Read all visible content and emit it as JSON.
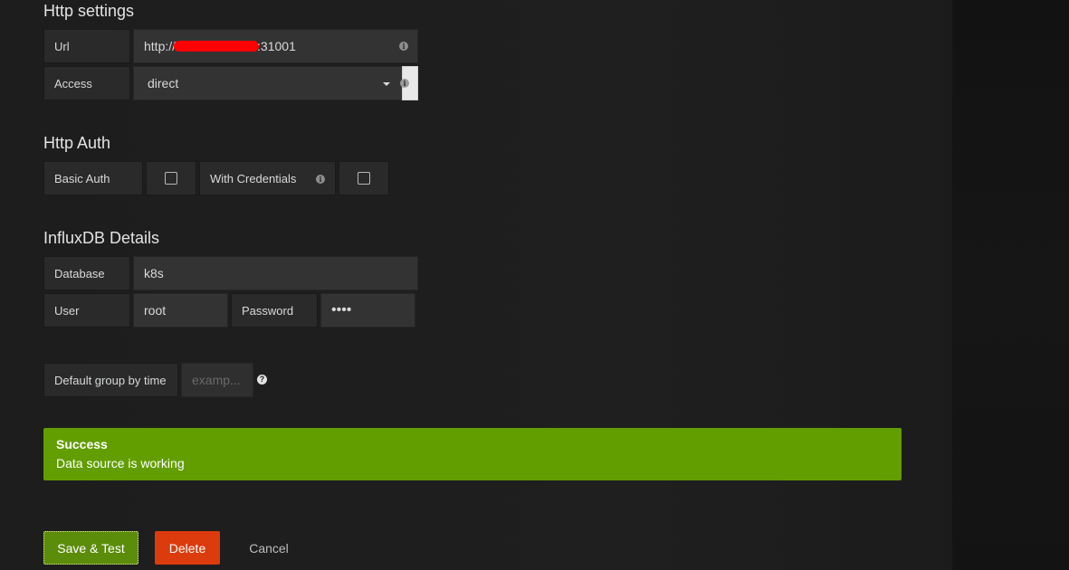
{
  "http_settings": {
    "title": "Http settings",
    "url_label": "Url",
    "url_prefix": "http://",
    "url_suffix": ":31001",
    "access_label": "Access",
    "access_value": "direct"
  },
  "http_auth": {
    "title": "Http Auth",
    "basic_auth_label": "Basic Auth",
    "basic_auth_checked": false,
    "with_credentials_label": "With Credentials",
    "with_credentials_checked": false
  },
  "influxdb": {
    "title": "InfluxDB Details",
    "database_label": "Database",
    "database_value": "k8s",
    "user_label": "User",
    "user_value": "root",
    "password_label": "Password",
    "password_value": "••••"
  },
  "group_by": {
    "label": "Default group by time",
    "placeholder": "examp..."
  },
  "alert": {
    "title": "Success",
    "text": "Data source is working",
    "color": "#629e00"
  },
  "actions": {
    "save_label": "Save & Test",
    "delete_label": "Delete",
    "cancel_label": "Cancel"
  }
}
